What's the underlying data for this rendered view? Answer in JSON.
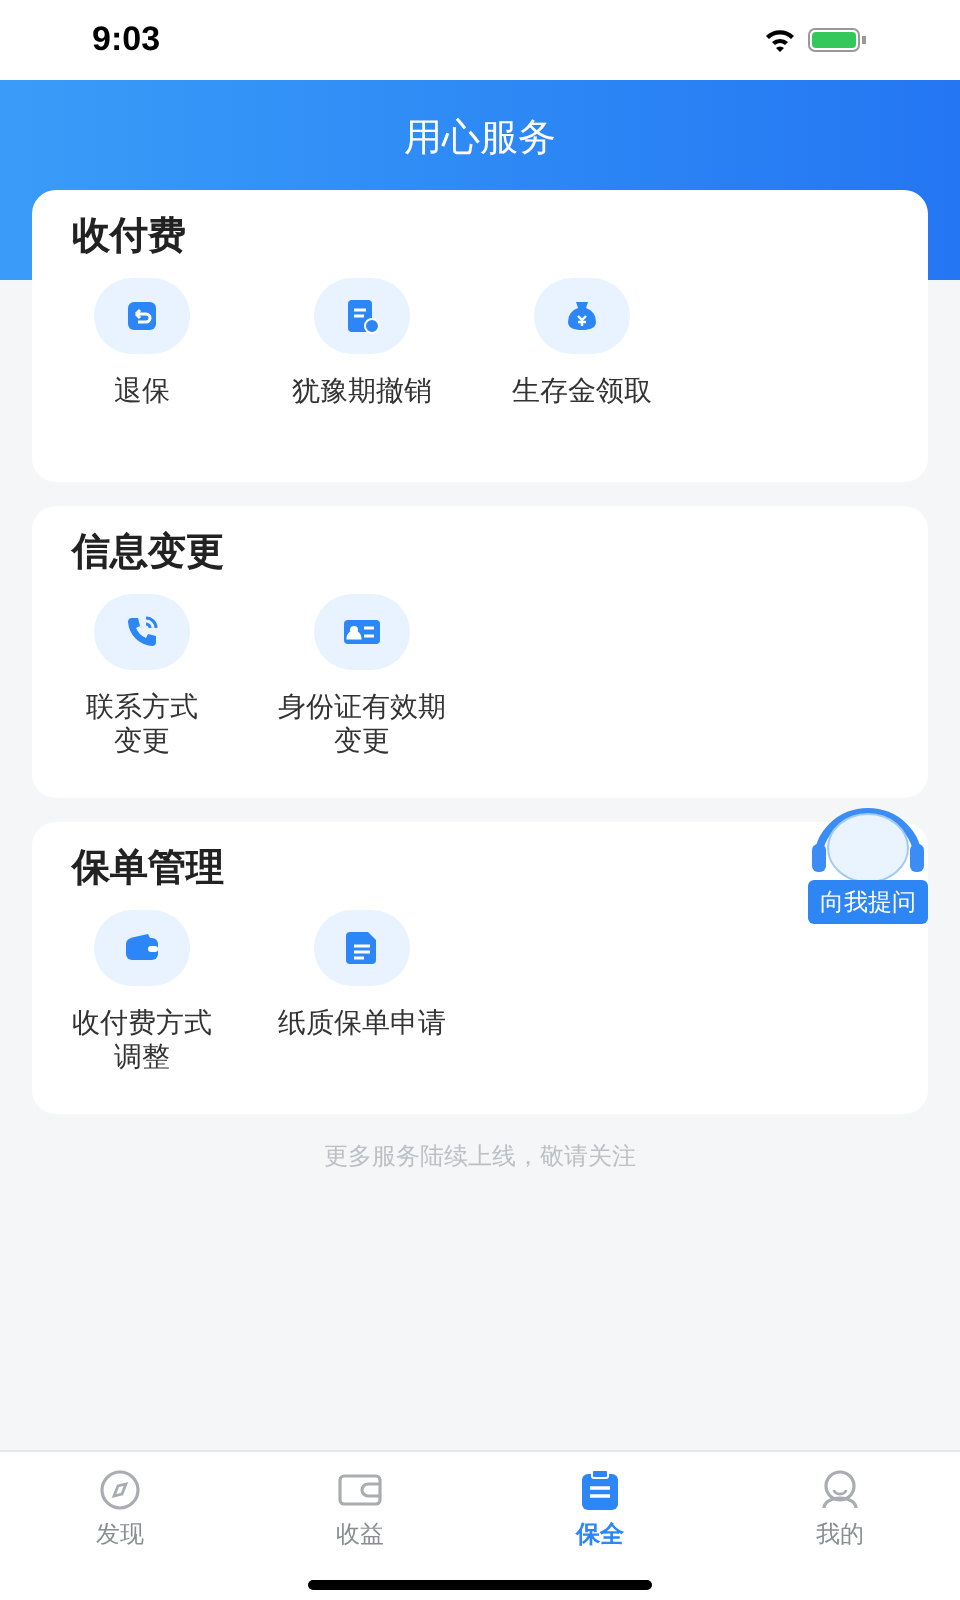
{
  "status_bar": {
    "time": "9:03"
  },
  "header": {
    "title": "用心服务"
  },
  "sections": [
    {
      "title": "收付费",
      "items": [
        {
          "label": "退保"
        },
        {
          "label": "犹豫期撤销"
        },
        {
          "label": "生存金领取"
        }
      ]
    },
    {
      "title": "信息变更",
      "items": [
        {
          "label": "联系方式变更"
        },
        {
          "label": "身份证有效期变更"
        }
      ]
    },
    {
      "title": "保单管理",
      "items": [
        {
          "label": "收付费方式调整"
        },
        {
          "label": "纸质保单申请"
        }
      ]
    }
  ],
  "footer_note": "更多服务陆续上线，敬请关注",
  "assistant": {
    "label": "向我提问"
  },
  "tab_bar": [
    {
      "label": "发现",
      "selected": false
    },
    {
      "label": "收益",
      "selected": false
    },
    {
      "label": "保全",
      "selected": true
    },
    {
      "label": "我的",
      "selected": false
    }
  ]
}
